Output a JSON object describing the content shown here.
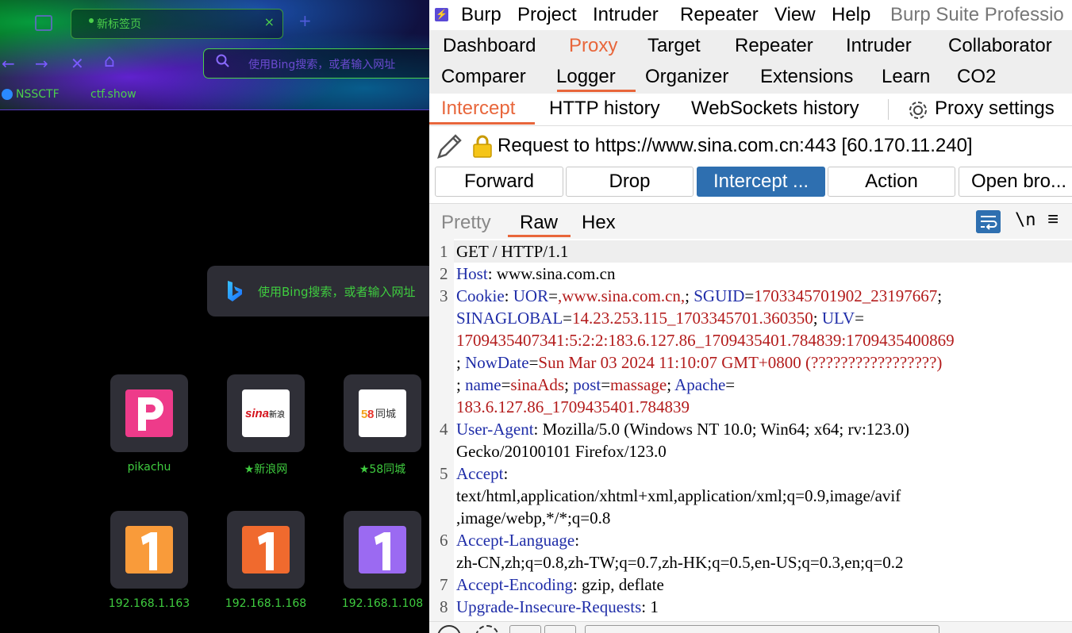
{
  "browser": {
    "tab_title": "新标签页",
    "tab_close": "×",
    "new_tab": "+",
    "nav": {
      "back": "←",
      "forward": "→",
      "stop": "✕",
      "home": "⌂"
    },
    "address_placeholder": "使用Bing搜索，或者输入网址",
    "bookmarks": [
      "NSSCTF",
      "ctf.show"
    ],
    "bing_search_text": "使用Bing搜索，或者输入网址",
    "tiles": [
      {
        "label": "pikachu",
        "glyph": "P",
        "color": "#ee3b8a"
      },
      {
        "label": "★新浪网",
        "glyph": "sina新浪",
        "color": "#ffffff"
      },
      {
        "label": "★58同城",
        "glyph": "58同城",
        "color": "#ffffff"
      },
      {
        "label": "192.168.1.163",
        "glyph": "1",
        "color": "#f99b3a"
      },
      {
        "label": "192.168.1.168",
        "glyph": "1",
        "color": "#f06a2e"
      },
      {
        "label": "192.168.1.108",
        "glyph": "1",
        "color": "#9b6af2"
      }
    ]
  },
  "burp": {
    "menu": [
      "Burp",
      "Project",
      "Intruder",
      "Repeater",
      "View",
      "Help"
    ],
    "window_title": "Burp Suite Professio",
    "top_tabs_row1": [
      "Dashboard",
      "Proxy",
      "Target",
      "Repeater",
      "Intruder",
      "Collaborator"
    ],
    "top_tabs_row2": [
      "Comparer",
      "Logger",
      "Organizer",
      "Extensions",
      "Learn",
      "CO2"
    ],
    "active_top_tab": "Proxy",
    "sub_tabs": [
      "Intercept",
      "HTTP history",
      "WebSockets history"
    ],
    "proxy_settings": "Proxy settings",
    "request_to": "Request to https://www.sina.com.cn:443  [60.170.11.240]",
    "buttons": [
      "Forward",
      "Drop",
      "Intercept ...",
      "Action",
      "Open bro..."
    ],
    "view_tabs": [
      "Pretty",
      "Raw",
      "Hex"
    ],
    "newline_toggle": "\\n",
    "menu_icon": "≡",
    "accent_color": "#e8663b",
    "primary_color": "#2e6fb0",
    "request_lines": [
      {
        "n": "1",
        "parts": [
          [
            "v",
            "GET / HTTP/1.1"
          ]
        ]
      },
      {
        "n": "2",
        "parts": [
          [
            "k",
            "Host"
          ],
          [
            "v",
            ": www.sina.com.cn"
          ]
        ]
      },
      {
        "n": "3",
        "parts": [
          [
            "k",
            "Cookie"
          ],
          [
            "v",
            ": "
          ],
          [
            "k",
            "UOR"
          ],
          [
            "v",
            "="
          ],
          [
            "r",
            ",www.sina.com.cn,"
          ],
          [
            "v",
            "; "
          ],
          [
            "k",
            "SGUID"
          ],
          [
            "v",
            "="
          ],
          [
            "r",
            "1703345701902_23197667"
          ],
          [
            "v",
            ";"
          ]
        ]
      },
      {
        "n": "",
        "parts": [
          [
            "k",
            "SINAGLOBAL"
          ],
          [
            "v",
            "="
          ],
          [
            "r",
            "14.23.253.115_1703345701.360350"
          ],
          [
            "v",
            "; "
          ],
          [
            "k",
            "ULV"
          ],
          [
            "v",
            "="
          ]
        ]
      },
      {
        "n": "",
        "parts": [
          [
            "r",
            "1709435407341:5:2:2:183.6.127.86_1709435401.784839:1709435400869"
          ]
        ]
      },
      {
        "n": "",
        "parts": [
          [
            "v",
            "; "
          ],
          [
            "k",
            "NowDate"
          ],
          [
            "v",
            "="
          ],
          [
            "r",
            "Sun Mar 03 2024 11:10:07 GMT+0800 (?????????????????)"
          ]
        ]
      },
      {
        "n": "",
        "parts": [
          [
            "v",
            "; "
          ],
          [
            "k",
            "name"
          ],
          [
            "v",
            "="
          ],
          [
            "r",
            "sinaAds"
          ],
          [
            "v",
            "; "
          ],
          [
            "k",
            "post"
          ],
          [
            "v",
            "="
          ],
          [
            "r",
            "massage"
          ],
          [
            "v",
            "; "
          ],
          [
            "k",
            "Apache"
          ],
          [
            "v",
            "="
          ]
        ]
      },
      {
        "n": "",
        "parts": [
          [
            "r",
            "183.6.127.86_1709435401.784839"
          ]
        ]
      },
      {
        "n": "4",
        "parts": [
          [
            "k",
            "User-Agent"
          ],
          [
            "v",
            ": Mozilla/5.0 (Windows NT 10.0; Win64; x64; rv:123.0)"
          ]
        ]
      },
      {
        "n": "",
        "parts": [
          [
            "v",
            "Gecko/20100101 Firefox/123.0"
          ]
        ]
      },
      {
        "n": "5",
        "parts": [
          [
            "k",
            "Accept"
          ],
          [
            "v",
            ":"
          ]
        ]
      },
      {
        "n": "",
        "parts": [
          [
            "v",
            "text/html,application/xhtml+xml,application/xml;q=0.9,image/avif"
          ]
        ]
      },
      {
        "n": "",
        "parts": [
          [
            "v",
            ",image/webp,*/*;q=0.8"
          ]
        ]
      },
      {
        "n": "6",
        "parts": [
          [
            "k",
            "Accept-Language"
          ],
          [
            "v",
            ":"
          ]
        ]
      },
      {
        "n": "",
        "parts": [
          [
            "v",
            "zh-CN,zh;q=0.8,zh-TW;q=0.7,zh-HK;q=0.5,en-US;q=0.3,en;q=0.2"
          ]
        ]
      },
      {
        "n": "7",
        "parts": [
          [
            "k",
            "Accept-Encoding"
          ],
          [
            "v",
            ": gzip, deflate"
          ]
        ]
      },
      {
        "n": "8",
        "parts": [
          [
            "k",
            "Upgrade-Insecure-Requests"
          ],
          [
            "v",
            ": 1"
          ]
        ]
      }
    ]
  }
}
